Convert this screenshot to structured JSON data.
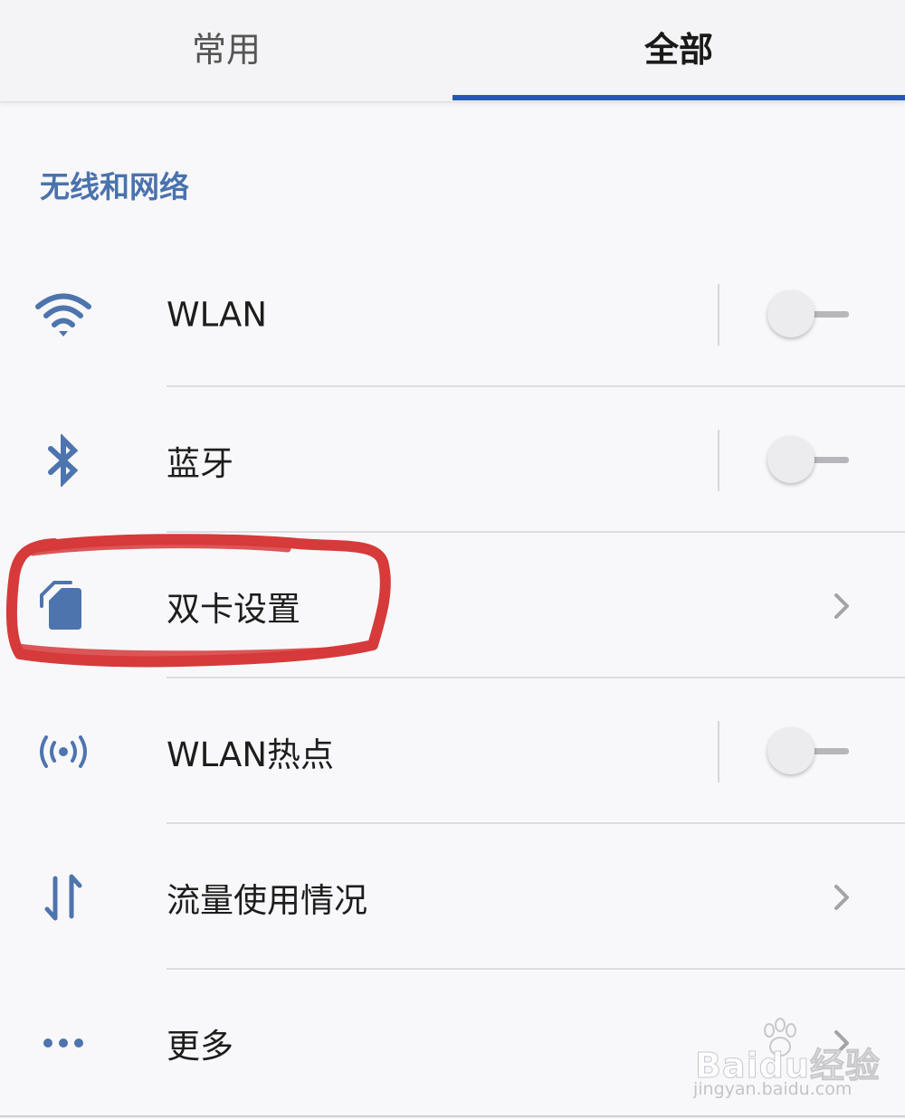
{
  "tabs": [
    {
      "label": "常用",
      "selected": false
    },
    {
      "label": "全部",
      "selected": true
    }
  ],
  "section": {
    "title": "无线和网络"
  },
  "rows": [
    {
      "label": "WLAN",
      "icon": "wifi-icon",
      "control": "switch",
      "on": false
    },
    {
      "label": "蓝牙",
      "icon": "bluetooth-icon",
      "control": "switch",
      "on": false
    },
    {
      "label": "双卡设置",
      "icon": "sim-card-icon",
      "control": "chevron"
    },
    {
      "label": "WLAN热点",
      "icon": "hotspot-icon",
      "control": "switch",
      "on": false
    },
    {
      "label": "流量使用情况",
      "icon": "data-usage-icon",
      "control": "chevron"
    },
    {
      "label": "更多",
      "icon": "more-icon",
      "control": "chevron"
    }
  ],
  "watermark": {
    "brand": "Baidu经验",
    "url": "jingyan.baidu.com"
  },
  "colors": {
    "accent": "#2757b4",
    "icon": "#4e74ad",
    "section": "#4a72ad",
    "annotation": "#d63a3a"
  }
}
